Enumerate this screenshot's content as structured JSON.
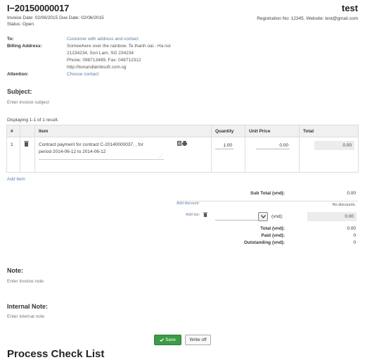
{
  "header": {
    "invoice_no": "I−20150000017",
    "company": "test",
    "dates": "Invoice Date: 02/06/2015 Due Date: 02/06/2015",
    "status": "Status: Open",
    "registration": "Registration No: 12345. Website: test@gmail.com"
  },
  "customer": {
    "to_label": "To:",
    "billing_label": "Billing Address:",
    "attention_label": "Attention:",
    "name": "Customer with address and contact",
    "address1": "Somewhere over the rainbow. Te thanh oai - Ha noi",
    "address2": "21234234, Son Lam, SG 234234",
    "phone": "Phone: 098713489, Fax: 048712312",
    "website": "http://lionandlambsoft.com.sg",
    "attention": "Choose contact"
  },
  "subject": {
    "title": "Subject:",
    "placeholder": "Enter invoice subject"
  },
  "items": {
    "summary": "Displaying 1-1 of 1 result.",
    "columns": [
      "#",
      "",
      "Item",
      "Quantity",
      "Unit Price",
      "Total"
    ],
    "rows": [
      {
        "index": "1",
        "description_line1": "Contract payment for contract C-20140000037, , for",
        "description_line2": "period 2014-06-12 to 2014-06-12",
        "quantity": "1.00",
        "unit_price": "0.00",
        "total": "0.00"
      }
    ],
    "add_item": "Add item"
  },
  "summary": {
    "subtotal_label": "Sub Total (vnd):",
    "subtotal": "0.00",
    "add_discount": "Add discount",
    "no_discounts": "No discounts.",
    "add_tax": "Add tax:",
    "tax_unit": "(vnd):",
    "tax_value": "0.00",
    "total_label": "Total (vnd):",
    "total": "0.00",
    "paid_label": "Paid (vnd):",
    "paid": "0",
    "outstanding_label": "Outstanding (vnd):",
    "outstanding": "0"
  },
  "note": {
    "title": "Note:",
    "placeholder": "Enter invoice note"
  },
  "internal_note": {
    "title": "Internal Note:",
    "placeholder": "Enter internal note"
  },
  "actions": {
    "save": "Save",
    "write_off": "Write off"
  },
  "checklist": {
    "title": "Process Check List"
  },
  "icons": {
    "trash": "trash-icon",
    "notes": "notes-icon",
    "print": "print-icon",
    "check": "check-icon",
    "dropdown": "chevron-down-icon",
    "resize": "resize-grip-icon"
  },
  "colors": {
    "save_button": "#3c9b47",
    "link": "#5a7fa8",
    "header_bg": "#f0f0f0"
  }
}
